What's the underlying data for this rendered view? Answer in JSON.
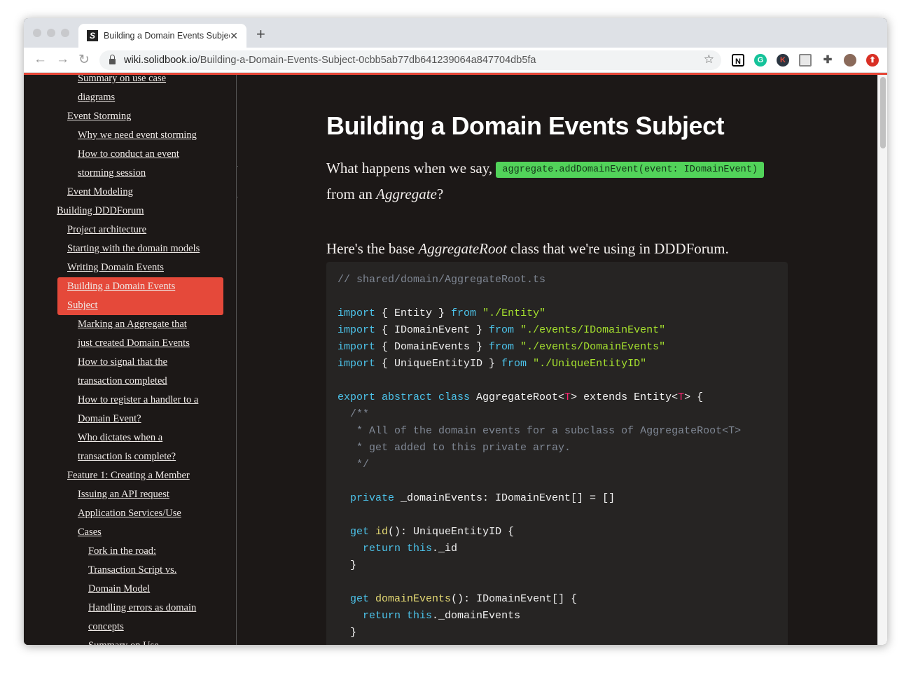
{
  "browser": {
    "tab_title": "Building a Domain Events Subject",
    "favicon": "S",
    "url_domain": "wiki.solidbook.io",
    "url_path": "/Building-a-Domain-Events-Subject-0cbb5ab77db641239064a847704db5fa",
    "extensions": [
      {
        "name": "notion",
        "color": "#ffffff",
        "label": "N"
      },
      {
        "name": "grammarly",
        "color": "#15c39a",
        "label": "G"
      },
      {
        "name": "k-extension",
        "color": "#2b3540",
        "label": "K"
      },
      {
        "name": "cast",
        "color": "#e8e8e8",
        "label": ""
      },
      {
        "name": "puzzle",
        "color": "#ffffff",
        "label": ""
      },
      {
        "name": "avatar",
        "color": "#8a6a5a",
        "label": ""
      },
      {
        "name": "update",
        "color": "#d93025",
        "label": "⬆"
      }
    ]
  },
  "sidebar": {
    "collapse_icon": "◀",
    "items": [
      {
        "level": 2,
        "lines": [
          "Summary on use case",
          "diagrams"
        ]
      },
      {
        "level": 1,
        "lines": [
          "Event Storming"
        ]
      },
      {
        "level": 2,
        "lines": [
          "Why we need event storming"
        ]
      },
      {
        "level": 2,
        "lines": [
          "How to conduct an event",
          "storming session"
        ]
      },
      {
        "level": 1,
        "lines": [
          "Event Modeling"
        ]
      },
      {
        "level": 0,
        "lines": [
          "Building DDDForum"
        ]
      },
      {
        "level": 1,
        "lines": [
          "Project architecture"
        ]
      },
      {
        "level": 1,
        "lines": [
          "Starting with the domain models"
        ]
      },
      {
        "level": 1,
        "lines": [
          "Writing Domain Events"
        ]
      },
      {
        "level": 1,
        "active": true,
        "lines": [
          "Building a Domain Events",
          "Subject"
        ]
      },
      {
        "level": 2,
        "lines": [
          "Marking an Aggregate that",
          "just created Domain Events"
        ]
      },
      {
        "level": 2,
        "lines": [
          "How to signal that the",
          "transaction completed"
        ]
      },
      {
        "level": 2,
        "lines": [
          "How to register a handler to a",
          "Domain Event?"
        ]
      },
      {
        "level": 2,
        "lines": [
          "Who dictates when a",
          "transaction is complete?"
        ]
      },
      {
        "level": 1,
        "lines": [
          "Feature 1: Creating a Member"
        ]
      },
      {
        "level": 2,
        "lines": [
          "Issuing an API request"
        ]
      },
      {
        "level": 2,
        "lines": [
          "Application Services/Use",
          "Cases"
        ]
      },
      {
        "level": 3,
        "lines": [
          "Fork in the road:"
        ]
      },
      {
        "level": 3,
        "lines": [
          "Transaction Script vs.",
          "Domain Model"
        ]
      },
      {
        "level": 3,
        "lines": [
          "Handling errors as domain",
          "concepts"
        ]
      },
      {
        "level": 3,
        "lines": [
          "Summary on Use"
        ]
      }
    ]
  },
  "main": {
    "title": "Building a Domain Events Subject",
    "p1_before": "What happens when we say, ",
    "p1_code": "aggregate.addDomainEvent(event: IDomainEvent)",
    "p1_after": "from an ",
    "p1_em": "Aggregate",
    "p1_end": "?",
    "p2_before": "Here's the base ",
    "p2_em": "AggregateRoot",
    "p2_after": " class that we're using in DDDForum.",
    "code": [
      [
        [
          "// shared/domain/AggregateRoot.ts",
          "c"
        ]
      ],
      [],
      [
        [
          "import",
          "k"
        ],
        [
          " { Entity } ",
          ""
        ],
        [
          "from",
          "k"
        ],
        [
          " \"./Entity\"",
          "s"
        ]
      ],
      [
        [
          "import",
          "k"
        ],
        [
          " { IDomainEvent } ",
          ""
        ],
        [
          "from",
          "k"
        ],
        [
          " \"./events/IDomainEvent\"",
          "s"
        ]
      ],
      [
        [
          "import",
          "k"
        ],
        [
          " { DomainEvents } ",
          ""
        ],
        [
          "from",
          "k"
        ],
        [
          " \"./events/DomainEvents\"",
          "s"
        ]
      ],
      [
        [
          "import",
          "k"
        ],
        [
          " { UniqueEntityID } ",
          ""
        ],
        [
          "from",
          "k"
        ],
        [
          " \"./UniqueEntityID\"",
          "s"
        ]
      ],
      [],
      [
        [
          "export abstract class",
          "k"
        ],
        [
          " AggregateRoot<",
          ""
        ],
        [
          "T",
          "g"
        ],
        [
          "> extends Entity<",
          ""
        ],
        [
          "T",
          "g"
        ],
        [
          "> {",
          ""
        ]
      ],
      [
        [
          "  /**",
          "c"
        ]
      ],
      [
        [
          "   * All of the domain events for a subclass of AggregateRoot<T>",
          "c"
        ]
      ],
      [
        [
          "   * get added to this private array.",
          "c"
        ]
      ],
      [
        [
          "   */",
          "c"
        ]
      ],
      [],
      [
        [
          "  private",
          "k"
        ],
        [
          " _domainEvents: IDomainEvent[] = []",
          ""
        ]
      ],
      [],
      [
        [
          "  get",
          "k"
        ],
        [
          " ",
          ""
        ],
        [
          "id",
          "f"
        ],
        [
          "(): UniqueEntityID {",
          ""
        ]
      ],
      [
        [
          "    return",
          "k"
        ],
        [
          " ",
          ""
        ],
        [
          "this",
          "k"
        ],
        [
          "._id",
          ""
        ]
      ],
      [
        [
          "  }",
          ""
        ]
      ],
      [],
      [
        [
          "  get",
          "k"
        ],
        [
          " ",
          ""
        ],
        [
          "domainEvents",
          "f"
        ],
        [
          "(): IDomainEvent[] {",
          ""
        ]
      ],
      [
        [
          "    return",
          "k"
        ],
        [
          " ",
          ""
        ],
        [
          "this",
          "k"
        ],
        [
          "._domainEvents",
          ""
        ]
      ],
      [
        [
          "  }",
          ""
        ]
      ]
    ]
  }
}
